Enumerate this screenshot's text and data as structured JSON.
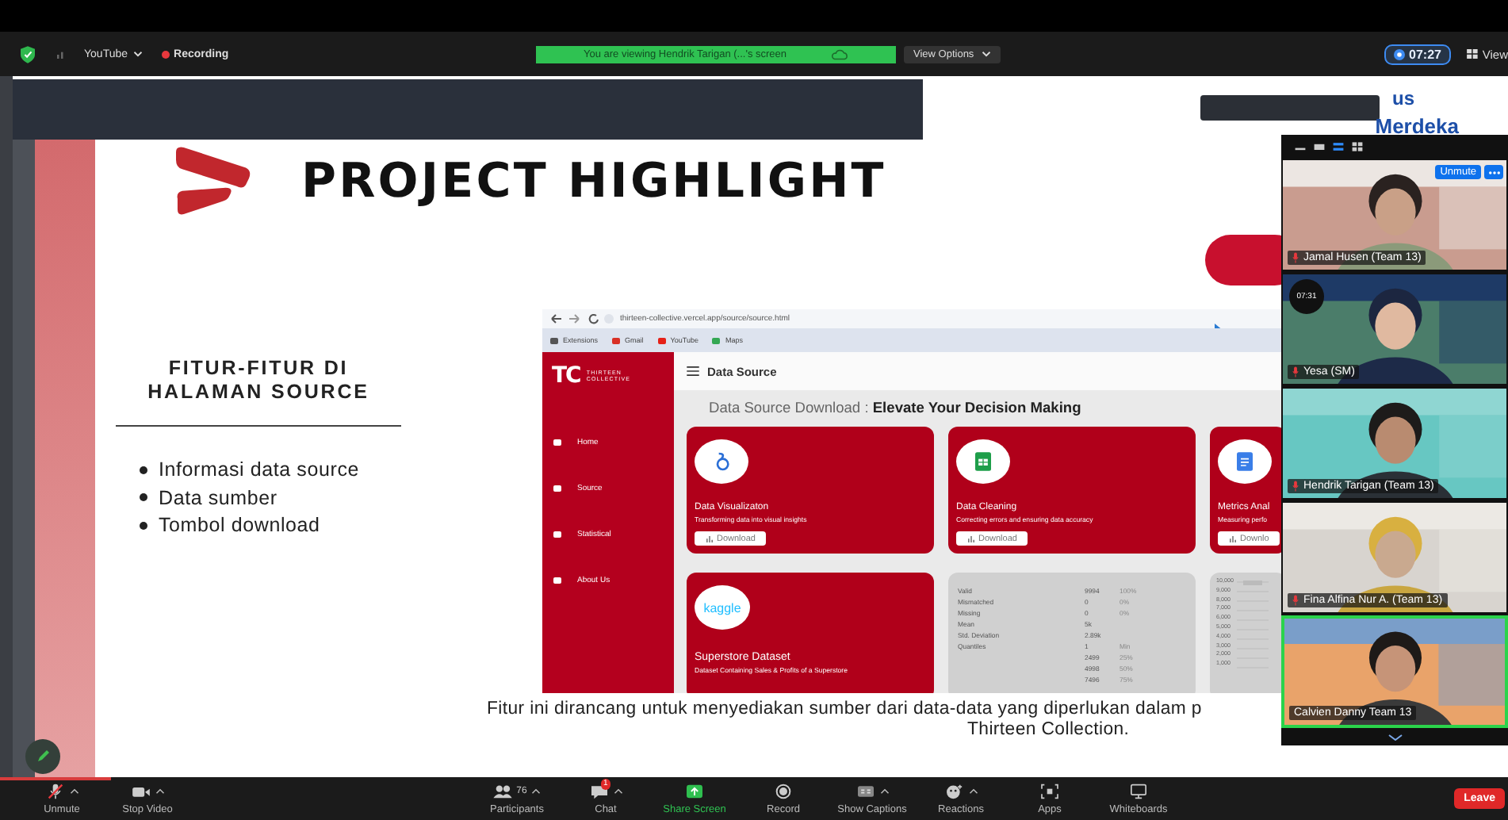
{
  "top_bar": {
    "app_menu": "YouTube",
    "recording": "Recording",
    "banner": "You are viewing Hendrik Tarigan (...'s screen",
    "view_options": "View Options",
    "timer": "07:27",
    "view": "View"
  },
  "slide": {
    "title": "PROJECT HIGHLIGHT",
    "logo": {
      "line_1": "us",
      "line_2": "Merdeka"
    },
    "section_heading": "FITUR-FITUR DI HALAMAN SOURCE",
    "bullets": [
      "Informasi data source",
      "Data sumber",
      "Tombol download"
    ],
    "caption_lines": [
      "Fitur ini dirancang untuk menyediakan sumber dari data-data yang diperlukan dalam p",
      "Thirteen Collection."
    ]
  },
  "screenshot": {
    "url": "thirteen-collective.vercel.app/source/source.html",
    "bookmarks": [
      "Extensions",
      "Gmail",
      "YouTube",
      "Maps"
    ],
    "brand": {
      "mark": "TC",
      "name": "THIRTEEN COLLECTIVE"
    },
    "nav": [
      "Home",
      "Source",
      "Statistical",
      "About Us"
    ],
    "page_title": "Data Source",
    "heading": "Data Source Download : **Elevate Your Decision Making**",
    "cards": [
      {
        "kind": "viz",
        "title": "Data Visualizaton",
        "description": "Transforming data into visual insights",
        "button": "Download"
      },
      {
        "kind": "sheet",
        "title": "Data Cleaning",
        "description": "Correcting errors and ensuring data accuracy",
        "button": "Download"
      },
      {
        "kind": "doc",
        "title": "Metrics Anal",
        "description": "Measuring perfo",
        "button": "Downlo"
      }
    ],
    "dataset_card": {
      "logo": "kaggle",
      "title": "Superstore Dataset",
      "description": "Dataset Containing Sales & Profits of a Superstore"
    },
    "stats": [
      {
        "label": "Valid",
        "value": "9994",
        "share": "100%"
      },
      {
        "label": "Mismatched",
        "value": "0",
        "share": "0%"
      },
      {
        "label": "Missing",
        "value": "0",
        "share": "0%"
      },
      {
        "label": "Mean",
        "value": "5k"
      },
      {
        "label": "Std. Deviation",
        "value": "2.89k"
      },
      {
        "label": "Quantiles",
        "value": "1",
        "share": "Min"
      },
      {
        "value": "2499",
        "share": "25%"
      },
      {
        "value": "4998",
        "share": "50%"
      },
      {
        "value": "7496",
        "share": "75%"
      }
    ],
    "chart_axis_labels": [
      "10,000",
      "9,000",
      "8,000",
      "7,000",
      "6,000",
      "5,000",
      "4,000",
      "3,000",
      "2,000",
      "1,000"
    ]
  },
  "video_panel": {
    "layout_buttons": [
      {
        "kind": "minimize",
        "selected": false
      },
      {
        "kind": "window",
        "selected": false
      },
      {
        "kind": "strip",
        "selected": true
      },
      {
        "kind": "grid",
        "selected": false
      }
    ],
    "participants": [
      {
        "name": "Jamal Husen (Team 13)",
        "muted": true,
        "speaking": false,
        "unmute_button": "Unmute"
      },
      {
        "name": "Yesa (SM)",
        "muted": true,
        "speaking": false,
        "timer": "07:31"
      },
      {
        "name": "Hendrik Tarigan (Team 13)",
        "muted": true,
        "speaking": false
      },
      {
        "name": "Fina Alfina Nur A. (Team 13)",
        "muted": true,
        "speaking": false
      },
      {
        "name": "Calvien Danny Team 13",
        "muted": false,
        "speaking": true
      }
    ]
  },
  "toolbar": [
    {
      "kind": "mic",
      "label": "Unmute",
      "caret": true
    },
    {
      "kind": "video",
      "label": "Stop Video",
      "caret": true
    },
    {
      "kind": "participants",
      "label": "Participants",
      "count": "76",
      "caret": true
    },
    {
      "kind": "chat",
      "label": "Chat",
      "badge": "1",
      "caret": true
    },
    {
      "kind": "share",
      "label": "Share Screen",
      "caret": false
    },
    {
      "kind": "record",
      "label": "Record",
      "caret": false
    },
    {
      "kind": "captions",
      "label": "Show Captions",
      "caret": true
    },
    {
      "kind": "reactions",
      "label": "Reactions",
      "caret": true
    },
    {
      "kind": "apps",
      "label": "Apps",
      "caret": false
    },
    {
      "kind": "whiteboard",
      "label": "Whiteboards",
      "caret": false
    }
  ],
  "leave": "Leave"
}
